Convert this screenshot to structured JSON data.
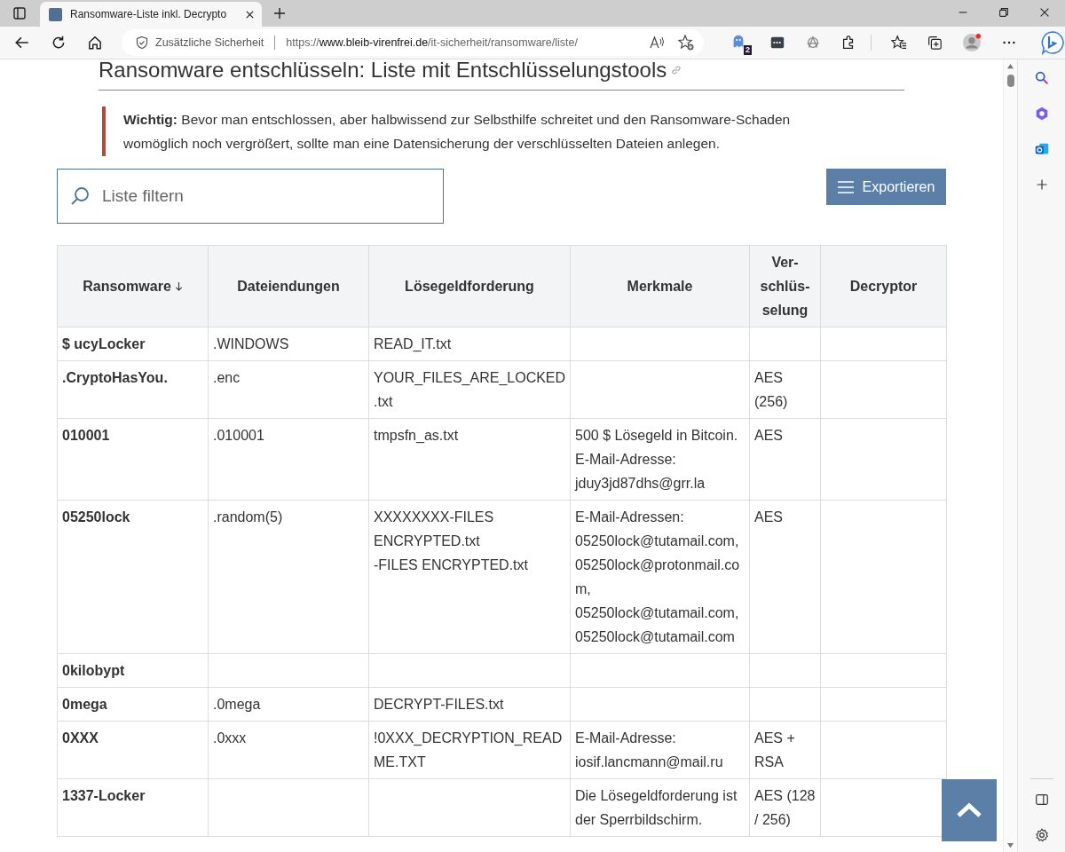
{
  "browser": {
    "tab_title": "Ransomware-Liste inkl. Decrypto",
    "security_label": "Zusätzliche Sicherheit",
    "url": {
      "scheme": "https://",
      "domain": "www.bleib-virenfrei.de",
      "path": "/it-sicherheit/ransomware/liste/"
    },
    "extension_badge": "2"
  },
  "page": {
    "heading": "Ransomware entschlüsseln: Liste mit Entschlüsselungstools",
    "notice": "**Wichtig:** Bevor man entschlossen, aber halbwissend zur Selbsthilfe schreitet und den Ransomware-Schaden womöglich noch vergrößert, sollte man eine Datensicherung der verschlüsselten Dateien anlegen.",
    "filter": {
      "placeholder": "Liste filtern"
    },
    "export_button": "Exportieren"
  },
  "table": {
    "columns": [
      {
        "label": "Ransomware",
        "sorted": true
      },
      {
        "label": "Dateiendungen",
        "sorted": false
      },
      {
        "label": "Lösegeldforderung",
        "sorted": false
      },
      {
        "label": "Merkmale",
        "sorted": false
      },
      {
        "label": "Ver-schlüs-selung",
        "sorted": false
      },
      {
        "label": "Decryptor",
        "sorted": false
      }
    ],
    "rows": [
      [
        "$ ucyLocker",
        ".WINDOWS",
        "READ_IT.txt",
        "",
        "",
        ""
      ],
      [
        ".CryptoHasYou.",
        ".enc",
        "YOUR_FILES_ARE_LOCKED.txt",
        "",
        "AES (256)",
        ""
      ],
      [
        "010001",
        ".010001",
        "tmpsfn_as.txt",
        "500 $ Lösegeld in Bitcoin. E-Mail-Adresse: jduy3jd87dhs@grr.la",
        "AES",
        ""
      ],
      [
        "05250lock",
        ".random(5)",
        "XXXXXXXX-FILES ENCRYPTED.txt\n-FILES ENCRYPTED.txt",
        "E-Mail-Adressen: 05250lock@tutamail.com, 05250lock@protonmail.com, 05250lock@tutamail.com, 05250lock@tutamail.com",
        "AES",
        ""
      ],
      [
        "0kilobypt",
        "",
        "",
        "",
        "",
        ""
      ],
      [
        "0mega",
        ".0mega",
        "DECRYPT-FILES.txt",
        "",
        "",
        ""
      ],
      [
        "0XXX",
        ".0xxx",
        "!0XXX_DECRYPTION_README.TXT",
        "E-Mail-Adresse: iosif.lancmann@mail.ru",
        "AES + RSA",
        ""
      ],
      [
        "1337-Locker",
        "",
        "",
        "Die Lösegeldforderung ist der Sperrbildschirm.",
        "AES (128 / 256)",
        ""
      ]
    ]
  }
}
